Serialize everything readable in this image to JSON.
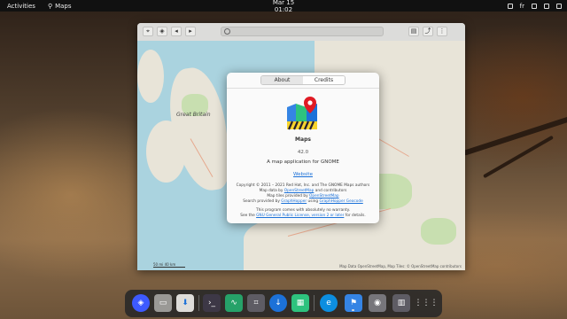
{
  "topbar": {
    "activities": "Activities",
    "app_name": "Maps",
    "clock": "Mar 15  01:02",
    "lang": "fr"
  },
  "map": {
    "labels": [
      "Great Britain"
    ],
    "scale_text": "50 mi   40 km",
    "attribution": "Map Data OpenStreetMap, Map Tiles: © OpenStreetMap contributors"
  },
  "dialog": {
    "tabs": [
      "About",
      "Credits"
    ],
    "app_name": "Maps",
    "version": "42.0",
    "description": "A map application for GNOME",
    "website_label": "Website",
    "copyright": "Copyright © 2011 – 2021 Red Hat, Inc. and The GNOME Maps authors",
    "map_data_prefix": "Map data by",
    "map_data_link": "OpenStreetMap",
    "map_data_suffix": "and contributors",
    "map_tiles_prefix": "Map tiles provided by",
    "map_tiles_link": "OpenStreetMap",
    "search_prefix": "Search provided by",
    "search_link1": "GraphHopper",
    "search_mid": "using",
    "search_link2": "GraphHopper Geocode",
    "warranty": "This program comes with absolutely no warranty.",
    "license_prefix": "See the",
    "license_link": "GNU General Public License, version 2 or later",
    "license_suffix": "for details."
  },
  "dock": {
    "items": [
      "compass-icon",
      "files-icon",
      "software-icon",
      "terminal-icon",
      "system-monitor-icon",
      "screenshot-icon",
      "download-icon",
      "spreadsheet-icon",
      "edge-icon",
      "maps-icon",
      "disk-icon",
      "trash-icon",
      "app-grid-icon"
    ]
  },
  "colors": {
    "accent": "#1c71d8",
    "topbar": "#111111",
    "water": "#aad3df"
  }
}
